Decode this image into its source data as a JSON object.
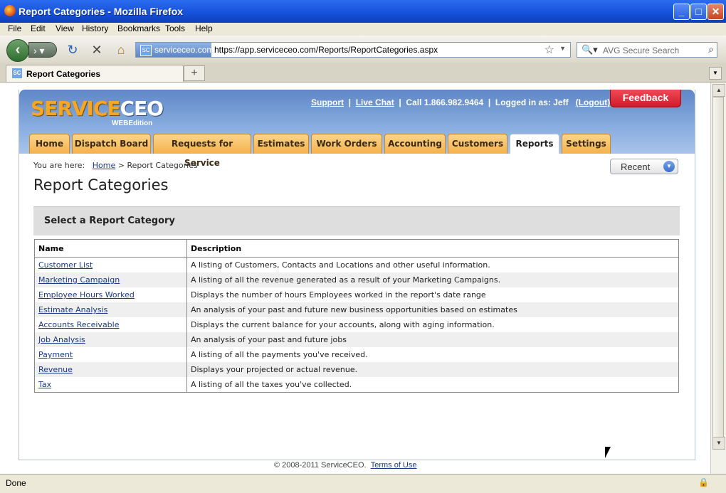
{
  "window": {
    "title": "Report Categories - Mozilla Firefox"
  },
  "menubar": [
    "File",
    "Edit",
    "View",
    "History",
    "Bookmarks",
    "Tools",
    "Help"
  ],
  "navbar": {
    "site_identity": "serviceceo.com",
    "url": "https://app.serviceceo.com/Reports/ReportCategories.aspx",
    "search_placeholder": "AVG Secure Search"
  },
  "tab": {
    "label": "Report Categories"
  },
  "header": {
    "logo_service": "SERVICE",
    "logo_ceo": "CEO",
    "logo_edition": "WEBEdition",
    "support": "Support",
    "live_chat": "Live Chat",
    "call": "Call 1.866.982.9464",
    "logged_in": "Logged in as: Jeff",
    "logout": "(Logout)",
    "feedback": "Feedback"
  },
  "nav_tabs": [
    "Home",
    "Dispatch Board",
    "Requests for Service",
    "Estimates",
    "Work Orders",
    "Accounting",
    "Customers",
    "Reports",
    "Settings"
  ],
  "breadcrumb": {
    "prefix": "You are here:",
    "home": "Home",
    "current": "> Report Categories"
  },
  "recent": "Recent",
  "page_title": "Report Categories",
  "section_heading": "Select a Report Category",
  "table": {
    "headers": [
      "Name",
      "Description"
    ],
    "rows": [
      [
        "Customer List",
        "A listing of Customers, Contacts and Locations and other useful information."
      ],
      [
        "Marketing Campaign",
        "A listing of all the revenue generated as a result of your Marketing Campaigns."
      ],
      [
        "Employee Hours Worked",
        "Displays the number of hours Employees worked in the report's date range"
      ],
      [
        "Estimate Analysis",
        "An analysis of your past and future new business opportunities based on estimates"
      ],
      [
        "Accounts Receivable",
        "Displays the current balance for your accounts, along with aging information."
      ],
      [
        "Job Analysis",
        "An analysis of your past and future jobs"
      ],
      [
        "Payment",
        "A listing of all the payments you've received."
      ],
      [
        "Revenue",
        "Displays your projected or actual revenue."
      ],
      [
        "Tax",
        "A listing of all the taxes you've collected."
      ]
    ]
  },
  "footer": {
    "copyright": "© 2008-2011 ServiceCEO.",
    "terms": "Terms of Use"
  },
  "status": "Done"
}
